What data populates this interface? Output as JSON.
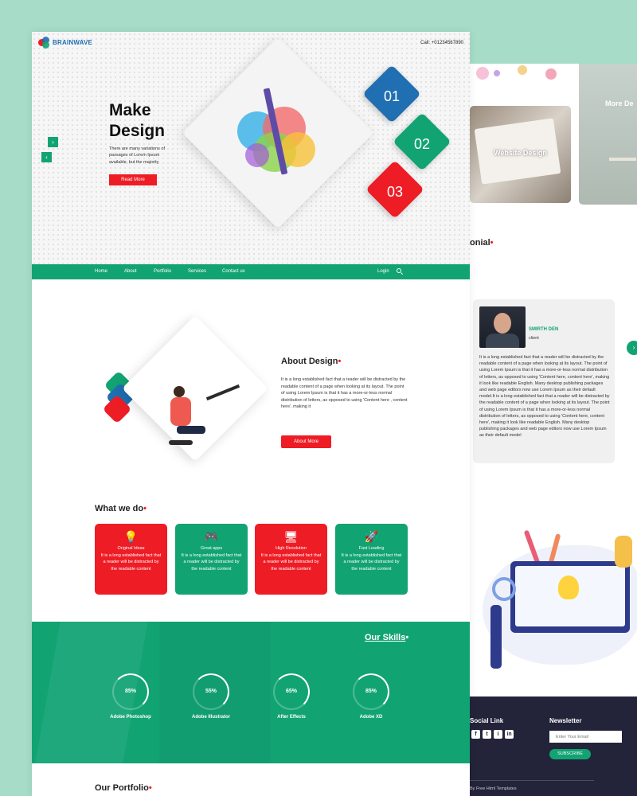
{
  "brand": {
    "name": "BRAINWAVE",
    "logo_colors": [
      "#ee1c25",
      "#1f6fb2",
      "#12a373"
    ]
  },
  "header": {
    "call": "Call: +01234567890"
  },
  "hero": {
    "title_line1": "Make",
    "title_line2": "Design",
    "text": "There are many variations of passages of Lorem Ipsum available, but the majority",
    "button": "Read More",
    "numbers": [
      "01",
      "02",
      "03"
    ]
  },
  "nav": {
    "items": [
      "Home",
      "About",
      "Portfolio",
      "Services",
      "Contact us"
    ],
    "login": "Login"
  },
  "about": {
    "title": "About Design",
    "text": "It is a long established fact that a reader will be distracted by the readable content of a page when looking at its layout. The point of using Lorem Ipsum is that it has a more-or-less normal distribution of letters, as opposed to using 'Content here , content here', making it",
    "button": "About More"
  },
  "whatwedo": {
    "title": "What we do",
    "cards": [
      {
        "title": "Original Ideas",
        "text": "It is a long established fact that a reader will be distracted by the readable content",
        "icon": "lightbulb-icon"
      },
      {
        "title": "Great apps",
        "text": "It is a long established fact that a reader will be distracted by the readable content",
        "icon": "gamepad-icon"
      },
      {
        "title": "High Resolution",
        "text": "It is a long established fact that a reader will be distracted by the readable content",
        "icon": "monitor-icon"
      },
      {
        "title": "Fast Loading",
        "text": "It is a long established fact that a reader will be distracted by the readable content",
        "icon": "rocket-icon"
      }
    ]
  },
  "skills": {
    "title": "Our Skills",
    "items": [
      {
        "pct": "85%",
        "label": "Adobe Photoshop"
      },
      {
        "pct": "55%",
        "label": "Adobe Illustrator"
      },
      {
        "pct": "65%",
        "label": "After Effects"
      },
      {
        "pct": "85%",
        "label": "Adobe XD"
      }
    ]
  },
  "portfolio": {
    "title": "Our Portfolio"
  },
  "right": {
    "portfolio_caption1": "Website Design",
    "portfolio_caption2": "More De",
    "testimonial_title": "onial",
    "testimonial_name": "SMIRTH DEN",
    "testimonial_role": "client",
    "testimonial_text": "It is a long established fact that a reader will be distracted by the readable content of a page when looking at its layout. The point of using Lorem Ipsum is that it has a more-or-less normal distribution of letters, as opposed to using 'Content here, content here', making it look like readable English. Many desktop publishing packages and web page editors now use Lorem Ipsum as their default model.It is a long established fact that a reader will be distracted by the readable content of a page when looking at its layout. The point of using Lorem Ipsum is that it has a more-or-less normal distribution of letters, as opposed to using 'Content here, content here', making it look like readable English. Many desktop publishing packages and web page editors now use Lorem Ipsum as their default model",
    "social_title": "Social Link",
    "social_icons": [
      "f",
      "t",
      "i",
      "in"
    ],
    "newsletter_title": "Newsletter",
    "newsletter_placeholder": "Enter Your Email",
    "subscribe": "SUBSCRIBE",
    "copyright": "By Free Html Templates"
  },
  "colors": {
    "green": "#12a373",
    "red": "#ee1c25",
    "blue": "#1f6fb2",
    "dark": "#23233a"
  }
}
